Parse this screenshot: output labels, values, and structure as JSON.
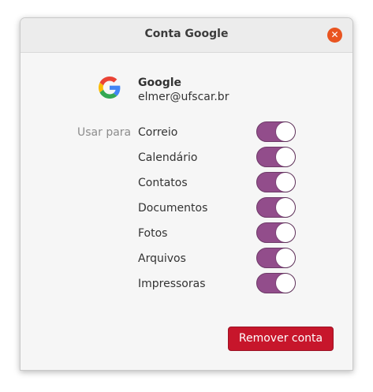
{
  "window": {
    "title": "Conta Google",
    "close_icon": "close-icon"
  },
  "account": {
    "provider": "Google",
    "email": "elmer@ufscar.br",
    "logo_icon": "google-logo-icon"
  },
  "use_for_label": "Usar para",
  "services": [
    {
      "label": "Correio",
      "enabled": true
    },
    {
      "label": "Calendário",
      "enabled": true
    },
    {
      "label": "Contatos",
      "enabled": true
    },
    {
      "label": "Documentos",
      "enabled": true
    },
    {
      "label": "Fotos",
      "enabled": true
    },
    {
      "label": "Arquivos",
      "enabled": true
    },
    {
      "label": "Impressoras",
      "enabled": true
    }
  ],
  "remove_button": "Remover conta",
  "colors": {
    "switch_on": "#924d8b",
    "close": "#e95420",
    "destructive": "#c7162b"
  }
}
